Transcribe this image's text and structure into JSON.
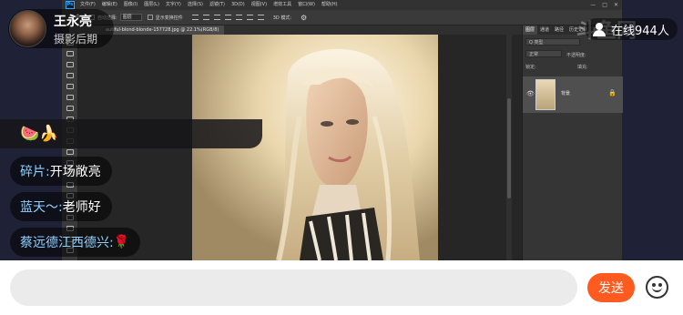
{
  "streamer": {
    "name": "王永亮",
    "subtitle": "摄影后期"
  },
  "online": {
    "watermark": "斗鱼网",
    "count_text": "在线944人"
  },
  "photoshop": {
    "logo": "Ps",
    "menus": [
      "文件(F)",
      "编辑(E)",
      "图像(I)",
      "图层(L)",
      "文字(Y)",
      "选择(S)",
      "滤镜(T)",
      "3D(D)",
      "视图(V)",
      "增效工具",
      "窗口(W)",
      "帮助(H)"
    ],
    "window_controls": [
      "—",
      "□",
      "✕"
    ],
    "options": {
      "auto_select_label": "自动选择:",
      "auto_select_value": "图层",
      "transform_label": "显示变换控件",
      "mode_3d": "3D 模式:"
    },
    "document_tab": "autiful-blond-blonde-157728.jpg @ 22.1%(RGB/8)",
    "panel_tabs": [
      "图层",
      "通道",
      "路径",
      "历史记录",
      "颜色"
    ],
    "panel_kind": "Q 类型",
    "panel_blend": "正常",
    "panel_opacity": "不透明度:",
    "panel_lock": "锁定:",
    "panel_fill": "填充:",
    "layer_name": "背景"
  },
  "chat": {
    "emoji_message": "🍉🍌",
    "messages": [
      {
        "user": "碎片:",
        "text": "开场敞亮"
      },
      {
        "user": "蓝天～:",
        "text": "老师好"
      },
      {
        "user": "蔡远德江西德兴:",
        "text": "🌹"
      }
    ]
  },
  "input": {
    "placeholder": "",
    "send_label": "发送"
  }
}
